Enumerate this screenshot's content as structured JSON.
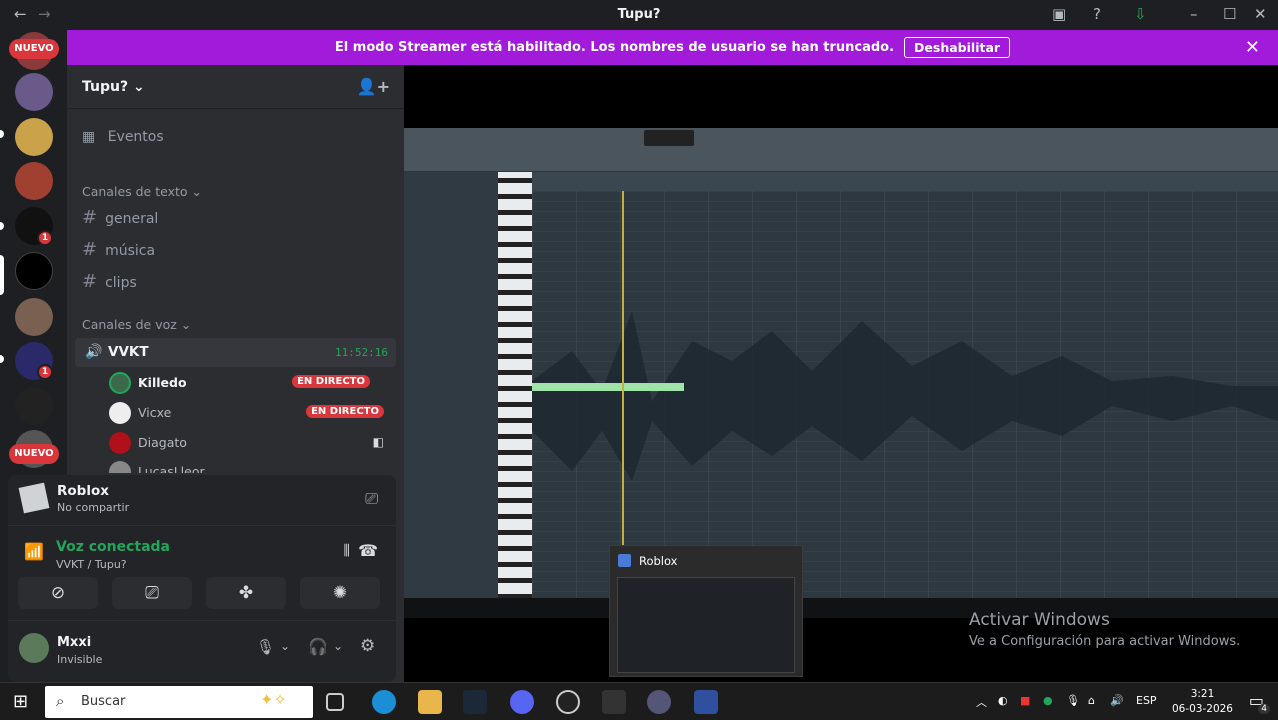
{
  "window": {
    "title": "Tupu?"
  },
  "streamer_bar": {
    "message": "El modo Streamer está habilitado. Los nombres de usuario se han truncado.",
    "button": "Deshabilitar"
  },
  "guilds": {
    "new_badge": "NUEVO",
    "badge_counts": [
      "1",
      "1"
    ]
  },
  "server": {
    "name": "Tupu?",
    "events": "Eventos",
    "text_category": "Canales de texto",
    "text_channels": [
      "general",
      "música",
      "clips"
    ],
    "voice_category": "Canales de voz",
    "voice_channel": {
      "name": "VVKT",
      "timer": "11:52:16"
    },
    "voice_users": [
      {
        "name": "Killedo",
        "live": "EN DIRECTO"
      },
      {
        "name": "Vicxe",
        "live": "EN DIRECTO"
      },
      {
        "name": "Diagato",
        "live": ""
      },
      {
        "name": "LucasLleor",
        "live": ""
      }
    ]
  },
  "activity": {
    "name": "Roblox",
    "status": "No compartir"
  },
  "voice_status": {
    "title": "Voz conectada",
    "subtitle": "VVKT / Tupu?"
  },
  "user": {
    "name": "Mxxi",
    "status": "Invisible"
  },
  "stream": {
    "thumb_title": "Roblox",
    "activate_title": "Activar Windows",
    "activate_sub": "Ve a Configuración para activar Windows."
  },
  "taskbar": {
    "search": "Buscar",
    "lang": "ESP",
    "time": "3:21",
    "date": "06-03-2026",
    "notif": "4"
  },
  "colors": {
    "accent": "#a21bdb",
    "live": "#da373c",
    "voice": "#23a55a"
  }
}
